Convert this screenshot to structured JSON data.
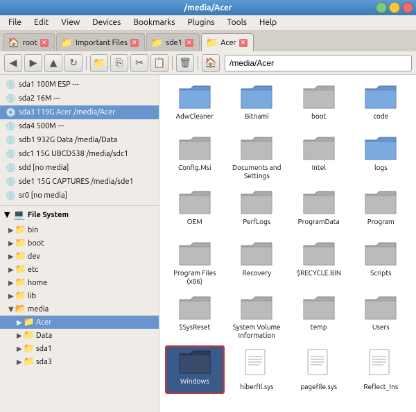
{
  "titleBar": {
    "title": "/media/Acer"
  },
  "menuBar": {
    "items": [
      "File",
      "Edit",
      "View",
      "Devices",
      "Bookmarks",
      "Plugins",
      "Tools",
      "Help"
    ]
  },
  "tabs": [
    {
      "id": "root",
      "label": "root",
      "icon": "🏠",
      "active": false
    },
    {
      "id": "important",
      "label": "Important Files",
      "icon": "📁",
      "active": false
    },
    {
      "id": "sde1",
      "label": "sde1",
      "icon": "📁",
      "active": false
    },
    {
      "id": "acer",
      "label": "Acer",
      "icon": "📁",
      "active": true
    }
  ],
  "toolbar": {
    "locationLabel": "/media/Acer"
  },
  "sidebar": {
    "drives": [
      {
        "label": "sda1 100M ESP ---",
        "active": false
      },
      {
        "label": "sda2 16M ---",
        "active": false
      },
      {
        "label": "sda3 119G Acer /media/Acer",
        "active": true
      },
      {
        "label": "sda4 500M ---",
        "active": false
      },
      {
        "label": "sdb1 932G Data /media/Data",
        "active": false
      },
      {
        "label": "sdc1 15G UBCD538 /media/sdc1",
        "active": false
      },
      {
        "label": "sdd [no media]",
        "active": false
      },
      {
        "label": "sde1 15G CAPTURES /media/sde1",
        "active": false
      },
      {
        "label": "sr0 [no media]",
        "active": false
      }
    ],
    "tree": {
      "rootLabel": "File System",
      "items": [
        {
          "label": "bin",
          "indent": 1,
          "expanded": false,
          "hasChildren": false
        },
        {
          "label": "boot",
          "indent": 1,
          "expanded": false,
          "hasChildren": false
        },
        {
          "label": "dev",
          "indent": 1,
          "expanded": false,
          "hasChildren": false
        },
        {
          "label": "etc",
          "indent": 1,
          "expanded": false,
          "hasChildren": false
        },
        {
          "label": "home",
          "indent": 1,
          "expanded": false,
          "hasChildren": false
        },
        {
          "label": "lib",
          "indent": 1,
          "expanded": false,
          "hasChildren": false
        },
        {
          "label": "media",
          "indent": 1,
          "expanded": true,
          "hasChildren": true
        },
        {
          "label": "Acer",
          "indent": 2,
          "expanded": false,
          "hasChildren": false,
          "active": true
        },
        {
          "label": "Data",
          "indent": 2,
          "expanded": false,
          "hasChildren": false
        },
        {
          "label": "sda1",
          "indent": 2,
          "expanded": false,
          "hasChildren": false
        },
        {
          "label": "sda3",
          "indent": 2,
          "expanded": false,
          "hasChildren": false
        }
      ]
    }
  },
  "files": [
    {
      "type": "folder",
      "label": "AdwCleaner",
      "color": "blue"
    },
    {
      "type": "folder",
      "label": "Bitnami",
      "color": "blue"
    },
    {
      "type": "folder",
      "label": "boot",
      "color": "gray"
    },
    {
      "type": "folder",
      "label": "code",
      "color": "blue",
      "partial": true
    },
    {
      "type": "folder",
      "label": "Config.Msi",
      "color": "gray"
    },
    {
      "type": "folder",
      "label": "Documents and Settings",
      "color": "gray"
    },
    {
      "type": "folder",
      "label": "Intel",
      "color": "gray"
    },
    {
      "type": "folder",
      "label": "logs",
      "color": "blue",
      "partial": true
    },
    {
      "type": "folder",
      "label": "OEM",
      "color": "gray"
    },
    {
      "type": "folder",
      "label": "PerfLogs",
      "color": "gray"
    },
    {
      "type": "folder",
      "label": "ProgramData",
      "color": "gray"
    },
    {
      "type": "folder",
      "label": "Program",
      "color": "gray",
      "partial": true
    },
    {
      "type": "folder",
      "label": "Program Files (x86)",
      "color": "gray"
    },
    {
      "type": "folder",
      "label": "Recovery",
      "color": "gray"
    },
    {
      "type": "folder",
      "label": "$RECYCLE.BIN",
      "color": "gray"
    },
    {
      "type": "folder",
      "label": "Scripts",
      "color": "gray",
      "partial": true
    },
    {
      "type": "folder",
      "label": "$SysReset",
      "color": "gray"
    },
    {
      "type": "folder",
      "label": "System Volume Information",
      "color": "gray"
    },
    {
      "type": "folder",
      "label": "temp",
      "color": "gray"
    },
    {
      "type": "folder",
      "label": "Users",
      "color": "gray",
      "partial": true
    },
    {
      "type": "folder",
      "label": "Windows",
      "color": "dark",
      "selected": true
    },
    {
      "type": "file",
      "label": "hiberfil.sys"
    },
    {
      "type": "file",
      "label": "pagefile.sys"
    },
    {
      "type": "file",
      "label": "Reflect_Ins",
      "partial": true
    }
  ]
}
